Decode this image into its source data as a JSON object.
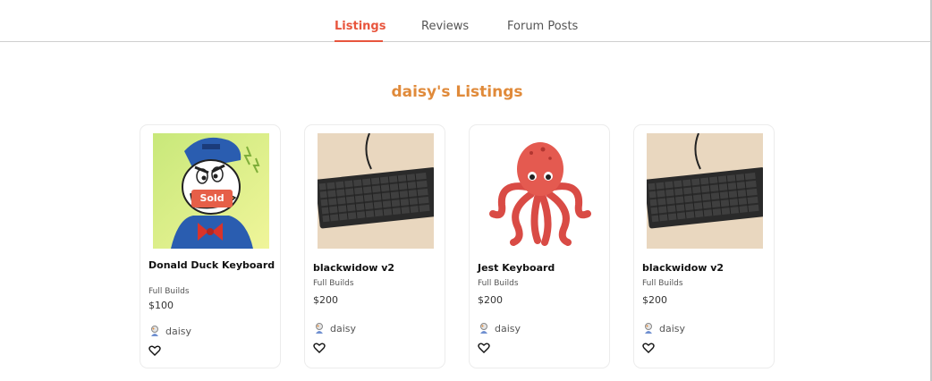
{
  "tabs": [
    {
      "label": "Listings",
      "active": true
    },
    {
      "label": "Reviews",
      "active": false
    },
    {
      "label": "Forum Posts",
      "active": false
    }
  ],
  "heading": "daisy's Listings",
  "colors": {
    "accent": "#e8553d",
    "heading": "#e08a3a",
    "sold_badge": "#e65f48"
  },
  "listings": [
    {
      "title": "Donald Duck Keyboard",
      "category": "Full Builds",
      "price": "$100",
      "seller": "daisy",
      "badge": "Sold",
      "image": "donald-duck-illustration"
    },
    {
      "title": "blackwidow v2",
      "category": "Full Builds",
      "price": "$200",
      "seller": "daisy",
      "image": "black-keyboard-photo"
    },
    {
      "title": "Jest Keyboard",
      "category": "Full Builds",
      "price": "$200",
      "seller": "daisy",
      "image": "red-octopus-illustration"
    },
    {
      "title": "blackwidow v2",
      "category": "Full Builds",
      "price": "$200",
      "seller": "daisy",
      "image": "black-keyboard-photo"
    }
  ]
}
